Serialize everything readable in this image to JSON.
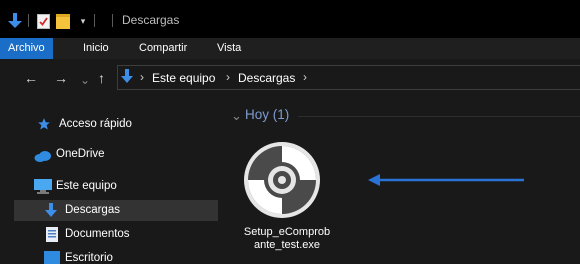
{
  "window": {
    "title": "Descargas"
  },
  "ribbon": {
    "tabs": [
      {
        "label": "Archivo",
        "active": true
      },
      {
        "label": "Inicio"
      },
      {
        "label": "Compartir"
      },
      {
        "label": "Vista"
      }
    ]
  },
  "address": {
    "breadcrumbs": [
      "Este equipo",
      "Descargas"
    ]
  },
  "sidebar": {
    "items": [
      {
        "label": "Acceso rápido",
        "icon": "star-icon"
      },
      {
        "label": "OneDrive",
        "icon": "cloud-icon"
      },
      {
        "label": "Este equipo",
        "icon": "computer-icon"
      },
      {
        "label": "Descargas",
        "icon": "download-arrow-icon",
        "selected": true
      },
      {
        "label": "Documentos",
        "icon": "document-icon"
      },
      {
        "label": "Escritorio",
        "icon": "desktop-icon"
      }
    ]
  },
  "content": {
    "group_label": "Hoy (1)",
    "file": {
      "name_line1": "Setup_eComprob",
      "name_line2": "ante_test.exe",
      "icon": "installer-disc-icon"
    }
  },
  "colors": {
    "accent": "#1a6ec7",
    "arrow": "#2a72d6",
    "group_title": "#7f9bd0",
    "selection": "#333333",
    "background": "#191919"
  }
}
